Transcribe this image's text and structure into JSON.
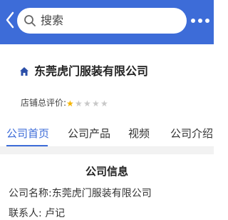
{
  "header": {
    "search_placeholder": "搜索",
    "colors": {
      "brand": "#3d6cd8"
    }
  },
  "company": {
    "name": "东莞虎门服装有限公司",
    "rating_label": "店铺总评价:",
    "rating_stars": 1,
    "rating_max": 5
  },
  "tabs": [
    {
      "label": "公司首页",
      "active": true
    },
    {
      "label": "公司产品",
      "active": false
    },
    {
      "label": "视频",
      "active": false
    },
    {
      "label": "公司介绍",
      "active": false
    }
  ],
  "info": {
    "title": "公司信息",
    "name_label": "公司名称:",
    "name_value": "东莞虎门服装有限公司",
    "contact_partial": "联系人: 卢记"
  }
}
